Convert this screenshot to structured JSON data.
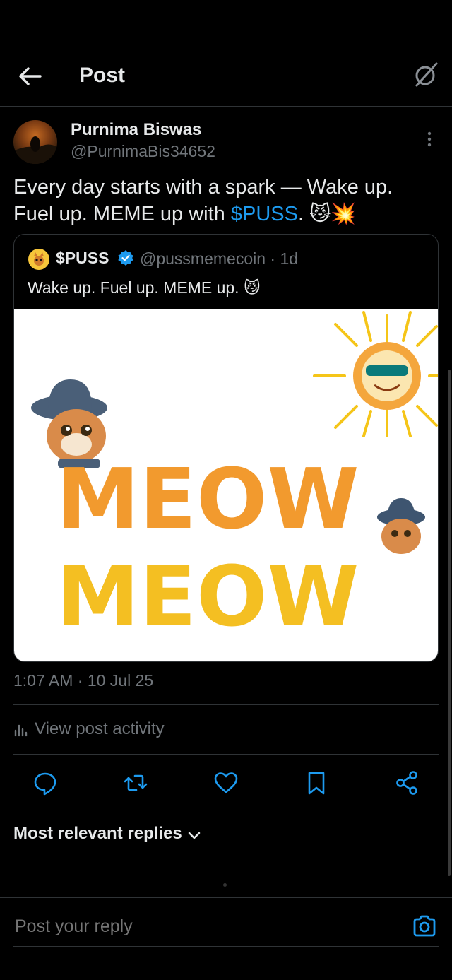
{
  "header": {
    "title": "Post"
  },
  "post": {
    "author_name": "Purnima Biswas",
    "author_handle": "@PurnimaBis34652",
    "text_before": "Every day starts with a spark — Wake up. Fuel up. MEME up with ",
    "cashtag": "$PUSS",
    "text_after": ". 😼💥",
    "timestamp": "1:07 AM · 10 Jul 25"
  },
  "quote": {
    "name": "$PUSS",
    "handle_time": "@pussmemecoin · 1d",
    "text": "Wake up. Fuel up. MEME up. 😼",
    "image_text_line1": "MEOW",
    "image_text_line2": "MEOW"
  },
  "activity": {
    "label": "View post activity"
  },
  "replies": {
    "sort_label": "Most relevant replies"
  },
  "reply_box": {
    "placeholder": "Post your reply"
  },
  "colors": {
    "accent": "#1d9bf0",
    "muted": "#71767b",
    "text": "#e7e9ea",
    "divider": "#2f3336"
  },
  "icons": [
    "back-arrow-icon",
    "grok-icon",
    "more-icon",
    "verified-icon",
    "chart-icon",
    "reply-icon",
    "repost-icon",
    "like-icon",
    "bookmark-icon",
    "share-icon",
    "chevron-down-icon",
    "camera-icon"
  ]
}
